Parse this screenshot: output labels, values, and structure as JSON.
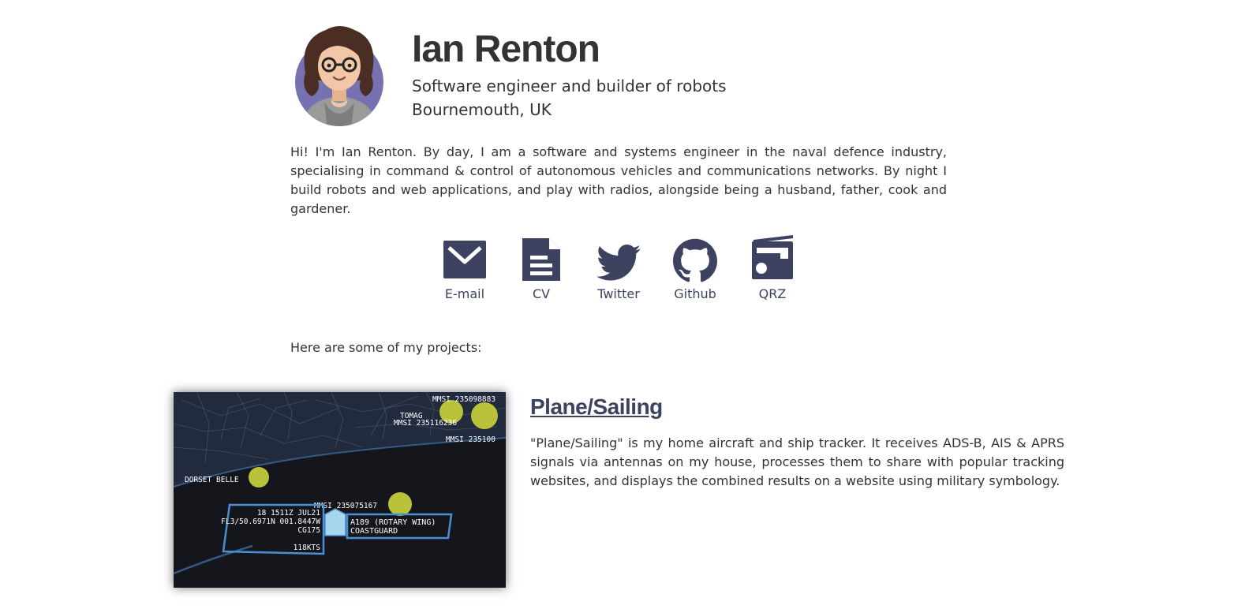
{
  "profile": {
    "name": "Ian Renton",
    "tagline": "Software engineer and builder of robots",
    "location": "Bournemouth, UK",
    "intro": "Hi! I'm Ian Renton. By day, I am a software and systems engineer in the naval defence industry, specialising in command & control of autonomous vehicles and communications networks. By night I build robots and web applications, and play with radios, alongside being a husband, father, cook and gardener."
  },
  "links": [
    {
      "label": "E-mail",
      "icon": "envelope-icon"
    },
    {
      "label": "CV",
      "icon": "document-icon"
    },
    {
      "label": "Twitter",
      "icon": "twitter-bird-icon"
    },
    {
      "label": "Github",
      "icon": "github-icon"
    },
    {
      "label": "QRZ",
      "icon": "radio-icon"
    }
  ],
  "projects_intro": "Here are some of my projects:",
  "projects": [
    {
      "title": "Plane/Sailing",
      "description": "\"Plane/Sailing\" is my home aircraft and ship tracker. It receives ADS-B, AIS & APRS signals via antennas on my house, processes them to share with popular tracking websites, and displays the combined results on a website using military symbology.",
      "screenshot_labels": {
        "mmsi_top": "MMSI 235098883",
        "tomag": "TOMAG",
        "mmsi_tomag": "MMSI 235116236",
        "mmsi_right": "MMSI 235100",
        "dorset_belle": "DORSET BELLE",
        "mmsi_center": "MMSI 235075167",
        "time": "18 1511Z JUL21",
        "position": "FL3/50.6971N 001.8447W",
        "callsign": "CG175",
        "speed": "118KTS",
        "aircraft_line1": "A189 (ROTARY WING)",
        "aircraft_line2": "COASTGUARD"
      }
    }
  ],
  "colors": {
    "text": "#333333",
    "accent": "#3d4260",
    "symbol_neutral": "#b9c23a",
    "symbol_friendly": "#a7d7ec",
    "callout_border": "#4a8fd1",
    "avatar_bg": "#7671b0"
  }
}
